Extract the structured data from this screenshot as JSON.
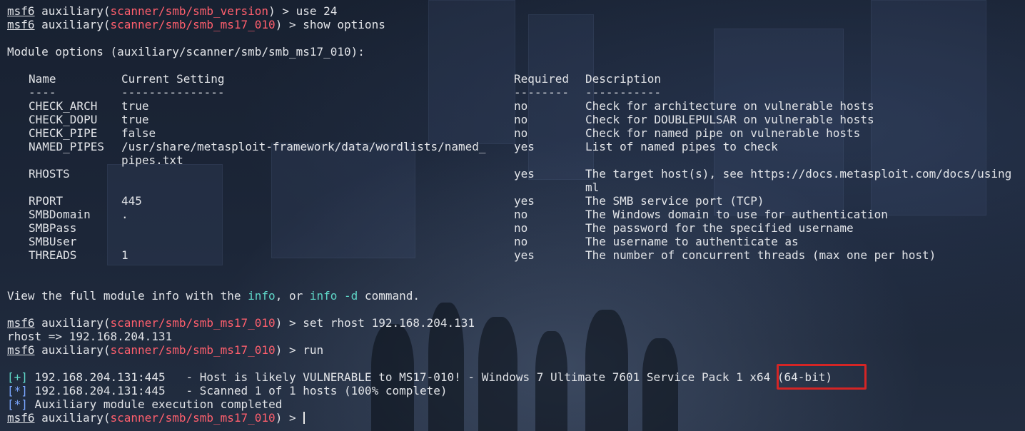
{
  "prompt": {
    "framework": "msf6",
    "word": "auxiliary(",
    "close": ")",
    "arrow": " > "
  },
  "modules": {
    "smb_version": "scanner/smb/smb_version",
    "ms17": "scanner/smb/smb_ms17_010"
  },
  "commands": {
    "use": "use 24",
    "show": "show options",
    "set": "set rhost 192.168.204.131",
    "run": "run"
  },
  "module_options_header": "Module options (auxiliary/scanner/smb/smb_ms17_010):",
  "options_table": {
    "headers": [
      "Name",
      "Current Setting",
      "Required",
      "Description"
    ],
    "underlines": [
      "----",
      "---------------",
      "--------",
      "-----------"
    ],
    "rows": [
      {
        "name": "CHECK_ARCH",
        "setting": "true",
        "required": "no",
        "description": "Check for architecture on vulnerable hosts"
      },
      {
        "name": "CHECK_DOPU",
        "setting": "true",
        "required": "no",
        "description": "Check for DOUBLEPULSAR on vulnerable hosts"
      },
      {
        "name": "CHECK_PIPE",
        "setting": "false",
        "required": "no",
        "description": "Check for named pipe on vulnerable hosts"
      },
      {
        "name": "NAMED_PIPES",
        "setting": "/usr/share/metasploit-framework/data/wordlists/named_",
        "setting_cont": "pipes.txt",
        "required": "yes",
        "description": "List of named pipes to check"
      },
      {
        "name": "RHOSTS",
        "setting": "",
        "required": "yes",
        "description": "The target host(s), see https://docs.metasploit.com/docs/using",
        "description_cont": "ml"
      },
      {
        "name": "RPORT",
        "setting": "445",
        "required": "yes",
        "description": "The SMB service port (TCP)"
      },
      {
        "name": "SMBDomain",
        "setting": ".",
        "required": "no",
        "description": "The Windows domain to use for authentication"
      },
      {
        "name": "SMBPass",
        "setting": "",
        "required": "no",
        "description": "The password for the specified username"
      },
      {
        "name": "SMBUser",
        "setting": "",
        "required": "no",
        "description": "The username to authenticate as"
      },
      {
        "name": "THREADS",
        "setting": "1",
        "required": "yes",
        "description": "The number of concurrent threads (max one per host)"
      }
    ]
  },
  "info_line": {
    "before": "View the full module info with the ",
    "info": "info",
    "mid": ", or ",
    "info_d": "info -d",
    "after": " command."
  },
  "rhost_echo": "rhost => 192.168.204.131",
  "results": [
    {
      "tag_open": "[",
      "tag": "+",
      "tag_close": "]",
      "text": " 192.168.204.131:445   - Host is likely VULNERABLE to MS17-010! - Windows 7 Ultimate 7601 Service Pack 1 x64 (64-bit)"
    },
    {
      "tag_open": "[",
      "tag": "*",
      "tag_close": "]",
      "text": " 192.168.204.131:445   - Scanned 1 of 1 hosts (100% complete)"
    },
    {
      "tag_open": "[",
      "tag": "*",
      "tag_close": "]",
      "text": " Auxiliary module execution completed"
    }
  ],
  "colors": {
    "background": "#1a2333",
    "foreground": "#e2e4e8",
    "module_red": "#ff5f6d",
    "keyword_cyan": "#5fd7c8",
    "status_blue": "#7aa6ff",
    "highlight_box": "#d42525"
  }
}
